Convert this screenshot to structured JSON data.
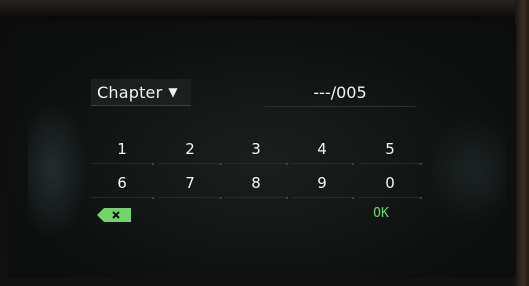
{
  "header": {
    "mode_label": "Chapter",
    "mode_arrow": "▼",
    "chapter_display": "---/005"
  },
  "keypad": {
    "row1": [
      "1",
      "2",
      "3",
      "4",
      "5"
    ],
    "row2": [
      "6",
      "7",
      "8",
      "9",
      "0"
    ],
    "ok_label": "OK",
    "backspace_icon": "backspace-x-icon"
  },
  "colors": {
    "accent_green": "#6fd66a",
    "text": "#f2f2ee",
    "screen_bg": "#101312"
  }
}
